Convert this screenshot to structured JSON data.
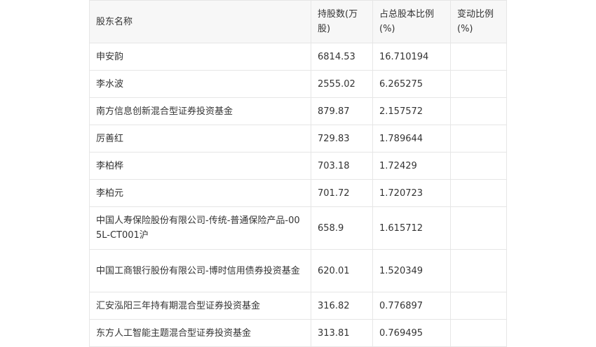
{
  "table": {
    "headers": [
      "股东名称",
      "持股数(万股)",
      "占总股本比例(%)",
      "变动比例(%)"
    ],
    "rows": [
      {
        "name": "申安韵",
        "shares": "6814.53",
        "ratio": "16.710194",
        "change": ""
      },
      {
        "name": "李水波",
        "shares": "2555.02",
        "ratio": "6.265275",
        "change": ""
      },
      {
        "name": "南方信息创新混合型证券投资基金",
        "shares": "879.87",
        "ratio": "2.157572",
        "change": ""
      },
      {
        "name": "厉善红",
        "shares": "729.83",
        "ratio": "1.789644",
        "change": ""
      },
      {
        "name": "李柏桦",
        "shares": "703.18",
        "ratio": "1.72429",
        "change": ""
      },
      {
        "name": "李柏元",
        "shares": "701.72",
        "ratio": "1.720723",
        "change": ""
      },
      {
        "name": "中国人寿保险股份有限公司-传统-普通保险产品-005L-CT001沪",
        "shares": "658.9",
        "ratio": "1.615712",
        "change": ""
      },
      {
        "name": "中国工商银行股份有限公司-博时信用债券投资基金",
        "shares": "620.01",
        "ratio": "1.520349",
        "change": ""
      },
      {
        "name": "汇安泓阳三年持有期混合型证券投资基金",
        "shares": "316.82",
        "ratio": "0.776897",
        "change": ""
      },
      {
        "name": "东方人工智能主题混合型证券投资基金",
        "shares": "313.81",
        "ratio": "0.769495",
        "change": ""
      }
    ]
  }
}
